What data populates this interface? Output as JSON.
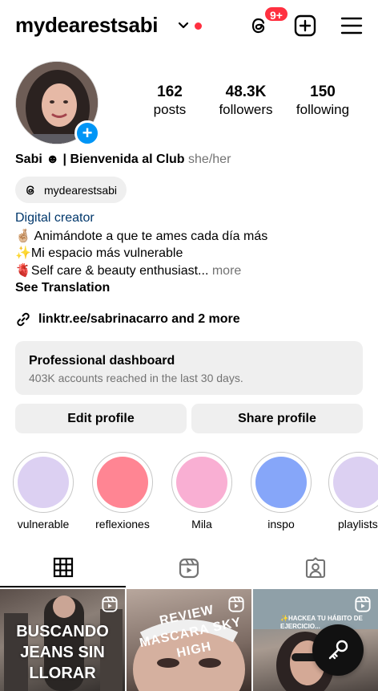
{
  "header": {
    "username": "mydearestsabi",
    "threads_badge": "9+"
  },
  "stats": {
    "posts_count": "162",
    "posts_label": "posts",
    "followers_count": "48.3K",
    "followers_label": "followers",
    "following_count": "150",
    "following_label": "following"
  },
  "bio": {
    "name": "Sabi ☻ | Bienvenida al Club",
    "pronouns": "she/her",
    "threads_handle": "mydearestsabi",
    "category": "Digital creator",
    "line1": "🤞🏼 Animándote a que te ames cada día más",
    "line2": "✨Mi espacio más vulnerable",
    "line3": "🫀Self care & beauty enthusiast...",
    "more": "more",
    "see_translation": "See Translation",
    "link": "linktr.ee/sabrinacarro and 2 more"
  },
  "dashboard": {
    "title": "Professional dashboard",
    "subtitle": "403K accounts reached in the last 30 days."
  },
  "buttons": {
    "edit": "Edit profile",
    "share": "Share profile"
  },
  "highlights": [
    {
      "label": "vulnerable",
      "color": "#dcd0f2"
    },
    {
      "label": "reflexiones",
      "color": "#ff8593"
    },
    {
      "label": "Mila",
      "color": "#f9afd3"
    },
    {
      "label": "inspo",
      "color": "#86a6f9"
    },
    {
      "label": "playlists",
      "color": "#dcd0f2"
    }
  ],
  "grid": {
    "post1_text": "BUSCANDO JEANS SIN LLORAR",
    "post2_text": "REVIEW MASCARA SKY HIGH",
    "post3_text": "✨HACKEA TU HÁBITO DE EJERCICIO..."
  },
  "icons": {
    "threads": "threads-icon",
    "add": "plus-square-icon",
    "menu": "hamburger-icon",
    "link": "link-icon",
    "grid_tab": "grid-icon",
    "reels_tab": "reels-icon",
    "tagged_tab": "tagged-icon",
    "fab": "key-icon"
  },
  "colors": {
    "accent_blue": "#0095f6",
    "notification_red": "#ff3040",
    "link_blue": "#00376b"
  }
}
